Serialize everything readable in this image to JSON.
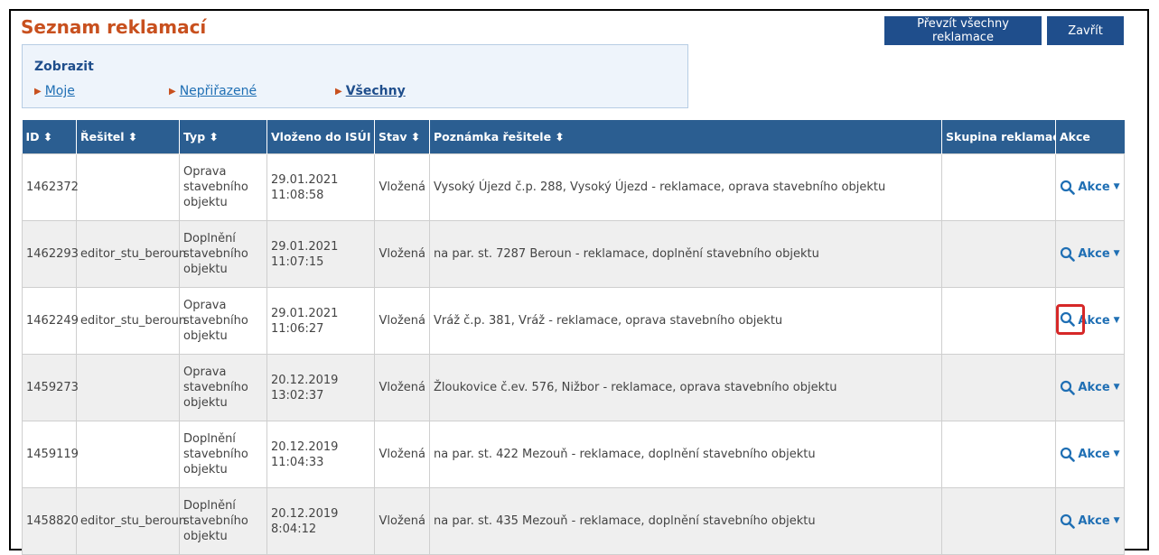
{
  "page_title": "Seznam reklamací",
  "buttons": {
    "take_all": "Převzít všechny reklamace",
    "close": "Zavřít"
  },
  "filter": {
    "title": "Zobrazit",
    "links": [
      "Moje",
      "Nepřiřazené",
      "Všechny"
    ],
    "active": "Všechny"
  },
  "table": {
    "headers": [
      "ID ⬍",
      "Řešitel ⬍",
      "Typ ⬍",
      "Vloženo do ISÚI ▾",
      "Stav ⬍",
      "Poznámka řešitele ⬍",
      "Skupina reklamací",
      "Akce"
    ],
    "action_label": "Akce",
    "rows": [
      {
        "id": "1462372",
        "resitel": "",
        "typ": "Oprava stavebního objektu",
        "vlozeno": "29.01.2021 11:08:58",
        "stav": "Vložená",
        "poznamka": "Vysoký Újezd č.p. 288, Vysoký Újezd - reklamace, oprava stavebního objektu",
        "skupina": ""
      },
      {
        "id": "1462293",
        "resitel": "editor_stu_beroun",
        "typ": "Doplnění stavebního objektu",
        "vlozeno": "29.01.2021 11:07:15",
        "stav": "Vložená",
        "poznamka": "na par. st. 7287 Beroun - reklamace, doplnění stavebního objektu",
        "skupina": ""
      },
      {
        "id": "1462249",
        "resitel": "editor_stu_beroun",
        "typ": "Oprava stavebního objektu",
        "vlozeno": "29.01.2021 11:06:27",
        "stav": "Vložená",
        "poznamka": "Vráž č.p. 381, Vráž - reklamace, oprava stavebního objektu",
        "skupina": ""
      },
      {
        "id": "1459273",
        "resitel": "",
        "typ": "Oprava stavebního objektu",
        "vlozeno": "20.12.2019 13:02:37",
        "stav": "Vložená",
        "poznamka": "Žloukovice č.ev. 576, Nižbor - reklamace, oprava stavebního objektu",
        "skupina": ""
      },
      {
        "id": "1459119",
        "resitel": "",
        "typ": "Doplnění stavebního objektu",
        "vlozeno": "20.12.2019 11:04:33",
        "stav": "Vložená",
        "poznamka": "na par. st. 422 Mezouň - reklamace, doplnění stavebního objektu",
        "skupina": ""
      },
      {
        "id": "1458820",
        "resitel": "editor_stu_beroun",
        "typ": "Doplnění stavebního objektu",
        "vlozeno": "20.12.2019 8:04:12",
        "stav": "Vložená",
        "poznamka": "na par. st. 435 Mezouň - reklamace, doplnění stavebního objektu",
        "skupina": ""
      }
    ]
  },
  "highlight_color": "#d62828",
  "accent_color": "#2b5e91"
}
